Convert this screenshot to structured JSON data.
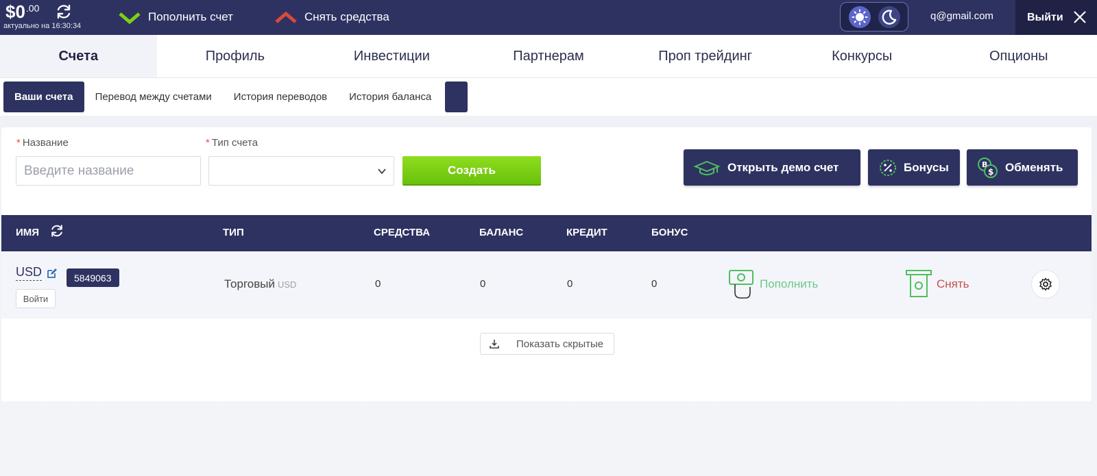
{
  "topbar": {
    "balance_main": "$0",
    "balance_cents": ".00",
    "updated_text": "актуально на 16:30:34",
    "deposit_label": "Пополнить счет",
    "withdraw_label": "Снять средства",
    "user_email": "q@gmail.com",
    "logout_label": "Выйти"
  },
  "main_nav": {
    "items": [
      {
        "label": "Счета",
        "active": true
      },
      {
        "label": "Профиль"
      },
      {
        "label": "Инвестиции"
      },
      {
        "label": "Партнерам"
      },
      {
        "label": "Проп трейдинг"
      },
      {
        "label": "Конкурсы"
      },
      {
        "label": "Опционы"
      }
    ]
  },
  "sub_nav": {
    "items": [
      {
        "label": "Ваши счета",
        "active": true
      },
      {
        "label": "Перевод между счетами"
      },
      {
        "label": "История переводов"
      },
      {
        "label": "История баланса"
      }
    ]
  },
  "create_form": {
    "name_label": "Название",
    "name_placeholder": "Введите название",
    "type_label": "Тип счета",
    "type_value": "",
    "create_label": "Создать",
    "required_mark": "*"
  },
  "actions": {
    "demo_label": "Открыть демо счет",
    "bonus_label": "Бонусы",
    "exchange_label": "Обменять"
  },
  "table": {
    "headers": {
      "name": "ИМЯ",
      "type": "ТИП",
      "funds": "СРЕДСТВА",
      "balance": "БАЛАНС",
      "credit": "КРЕДИТ",
      "bonus": "БОНУС"
    },
    "rows": [
      {
        "name": "USD",
        "number": "5849063",
        "login_label": "Войти",
        "type": "Торговый",
        "currency": "USD",
        "funds": "0",
        "balance": "0",
        "credit": "0",
        "bonus": "0",
        "deposit_label": "Пополнить",
        "withdraw_label": "Снять"
      }
    ],
    "show_hidden_label": "Показать скрытые"
  },
  "colors": {
    "brand_navy": "#2e3261",
    "create_green": "#7dd113",
    "deposit_green": "#6fc78a",
    "withdraw_red": "#c9504c"
  },
  "icons": {
    "balance_refresh": "refresh-icon",
    "deposit_top": "chevron-up-green-icon",
    "withdraw_top": "chevron-down-red-icon",
    "theme_light": "sun-icon",
    "theme_dark": "moon-icon",
    "logout": "close-icon",
    "demo": "graduation-cap-icon",
    "bonus": "percent-icon",
    "exchange": "coin-exchange-icon",
    "edit": "edit-icon",
    "settings": "gear-icon",
    "show_hidden": "download-icon"
  }
}
